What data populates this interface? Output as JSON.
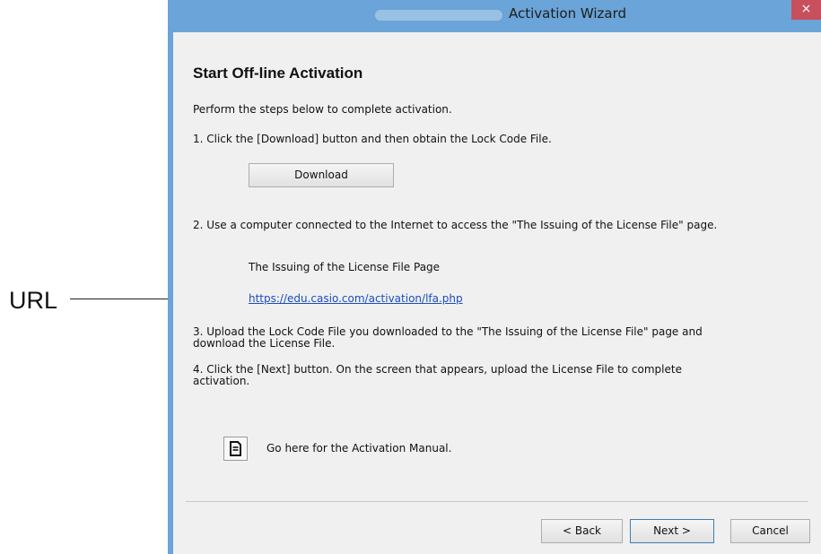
{
  "callout": {
    "label": "URL"
  },
  "window": {
    "title": "Activation Wizard",
    "close_glyph": "×"
  },
  "page": {
    "heading": "Start Off-line Activation",
    "intro": "Perform the steps below to complete activation.",
    "step1": "1. Click the [Download] button and then obtain the Lock Code File.",
    "download_label": "Download",
    "step2": "2. Use a computer connected to the Internet to access the \"The Issuing of the License File\" page.",
    "page_name": "The Issuing of the License File Page",
    "url": "https://edu.casio.com/activation/lfa.php",
    "step3_line1": "3. Upload the Lock Code File you downloaded to the \"The Issuing of the License File\" page and",
    "step3_line2": "download the License File.",
    "step4_line1": "4. Click the [Next] button. On the screen that appears, upload the License File to complete",
    "step4_line2": "activation.",
    "manual_text": "Go here for the Activation Manual.",
    "manual_icon": "document-icon"
  },
  "buttons": {
    "back": "< Back",
    "next": "Next >",
    "cancel": "Cancel"
  },
  "colors": {
    "titlebar": "#6aa4d8",
    "close": "#c7505c",
    "link": "#1a4dbf"
  }
}
